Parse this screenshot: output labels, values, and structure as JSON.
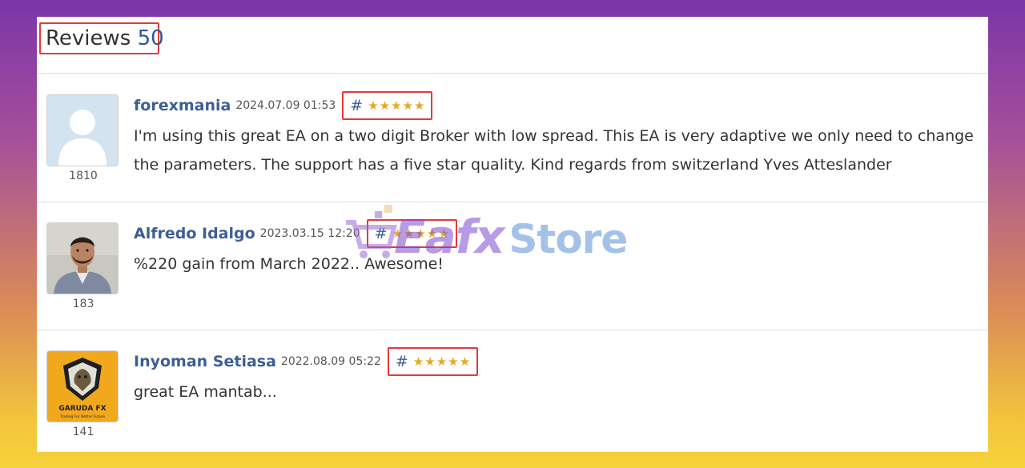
{
  "header": {
    "title": "Reviews",
    "count": "50"
  },
  "reviews": [
    {
      "author": "forexmania",
      "date": "2024.07.09 01:53",
      "hash": "#",
      "stars": 5,
      "avatar": "default-user-avatar",
      "rating_count": "1810",
      "text": "I'm using this great EA on a two digit Broker with low spread. This EA is very adaptive we only need to change the parameters. The support has a five star quality. Kind regards from switzerland Yves Atteslander"
    },
    {
      "author": "Alfredo Idalgo",
      "date": "2023.03.15 12:20",
      "hash": "#",
      "stars": 5,
      "avatar": "portrait-photo",
      "rating_count": "183",
      "text": "%220 gain from March 2022.. Awesome!"
    },
    {
      "author": "Inyoman Setiasa",
      "date": "2022.08.09 05:22",
      "hash": "#",
      "stars": 5,
      "avatar": "garuda-fx-logo",
      "avatar_logo_text": "GARUDA FX",
      "avatar_logo_subtext": "Trading For Better Future",
      "rating_count": "141",
      "text": "great EA mantab..."
    }
  ],
  "watermark": {
    "brand": "Eafx",
    "suffix": "Store"
  },
  "colors": {
    "author": "#3d5e96",
    "star": "#e8a81d",
    "highlight_box": "#e13a3a"
  }
}
